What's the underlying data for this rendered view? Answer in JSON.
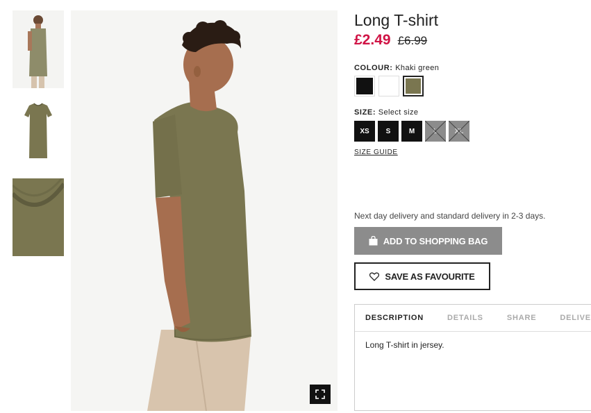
{
  "product": {
    "title": "Long T-shirt",
    "price_sale": "£2.49",
    "price_old": "£6.99"
  },
  "colour": {
    "label": "COLOUR:",
    "value": "Khaki green",
    "swatches": [
      {
        "name": "Black",
        "hex": "#111111"
      },
      {
        "name": "White",
        "hex": "#ffffff"
      },
      {
        "name": "Khaki green",
        "hex": "#7a7650"
      }
    ],
    "selected": 2
  },
  "size": {
    "label": "SIZE:",
    "value": "Select size",
    "options": [
      {
        "label": "XS",
        "available": true
      },
      {
        "label": "S",
        "available": true
      },
      {
        "label": "M",
        "available": true
      },
      {
        "label": "L",
        "available": false
      },
      {
        "label": "XL",
        "available": false
      }
    ],
    "guide_label": "SIZE GUIDE"
  },
  "delivery_text": "Next day delivery and standard delivery in 2-3 days.",
  "buttons": {
    "add_to_bag": "ADD TO SHOPPING BAG",
    "favourite": "SAVE AS FAVOURITE"
  },
  "tabs": {
    "items": [
      "DESCRIPTION",
      "DETAILS",
      "SHARE",
      "DELIVERY"
    ],
    "active": 0,
    "content": "Long T-shirt in jersey."
  },
  "colors": {
    "sale": "#d01345",
    "shirt": "#7a7650",
    "button_grey": "#8c8c8c"
  },
  "icons": {
    "bag": "shopping-bag-icon",
    "heart": "heart-icon",
    "fullscreen": "fullscreen-icon"
  }
}
